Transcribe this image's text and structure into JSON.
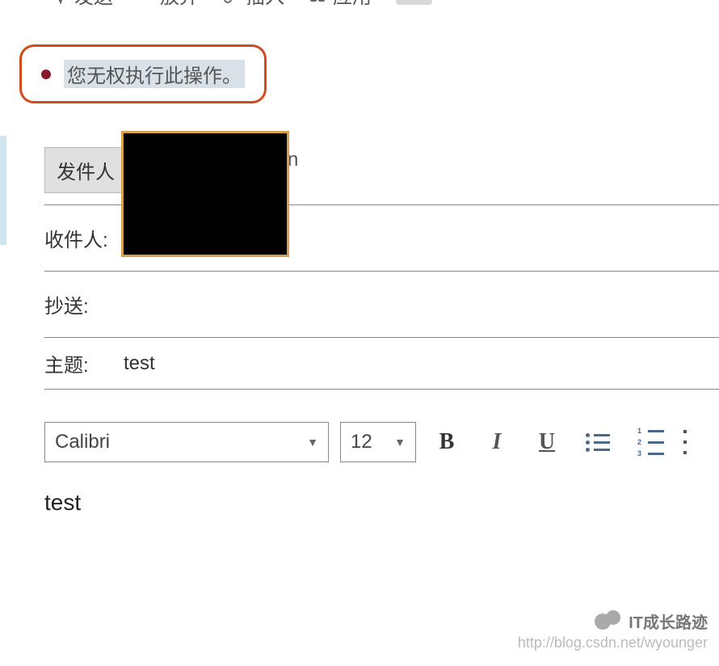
{
  "toolbar": {
    "send": "发送",
    "discard": "放弃",
    "insert": "插入",
    "addon": "应用"
  },
  "alert": {
    "message": "您无权执行此操作。"
  },
  "form": {
    "from_label": "发件人",
    "from_stray": "n",
    "to_label": "收件人:",
    "cc_label": "抄送:",
    "subject_label": "主题:",
    "subject_value": "test"
  },
  "editor": {
    "font": "Calibri",
    "size": "12",
    "body": "test"
  },
  "watermark": {
    "title": "IT成长路迹",
    "url": "http://blog.csdn.net/wyounger"
  }
}
